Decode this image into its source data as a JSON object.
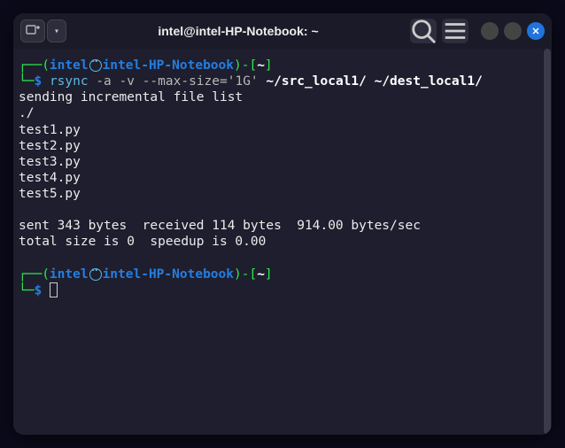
{
  "window": {
    "title": "intel@intel-HP-Notebook: ~"
  },
  "prompt1": {
    "open_bracket": "┌──(",
    "user": "intel",
    "host": "intel-HP-Notebook",
    "close_host": ")-[",
    "path": "~",
    "close_path": "]",
    "line2_start": "└─",
    "dollar": "$ ",
    "cmd_rsync": "rsync",
    "cmd_args": " -a -v --max-size='1G'",
    "cmd_paths": " ~/src_local1/ ~/dest_local1/"
  },
  "output": {
    "line1": "sending incremental file list",
    "line2": "./",
    "line3": "test1.py",
    "line4": "test2.py",
    "line5": "test3.py",
    "line6": "test4.py",
    "line7": "test5.py",
    "blank": " ",
    "line8": "sent 343 bytes  received 114 bytes  914.00 bytes/sec",
    "line9": "total size is 0  speedup is 0.00"
  },
  "prompt2": {
    "open_bracket": "┌──(",
    "user": "intel",
    "host": "intel-HP-Notebook",
    "close_host": ")-[",
    "path": "~",
    "close_path": "]",
    "line2_start": "└─",
    "dollar": "$ "
  }
}
